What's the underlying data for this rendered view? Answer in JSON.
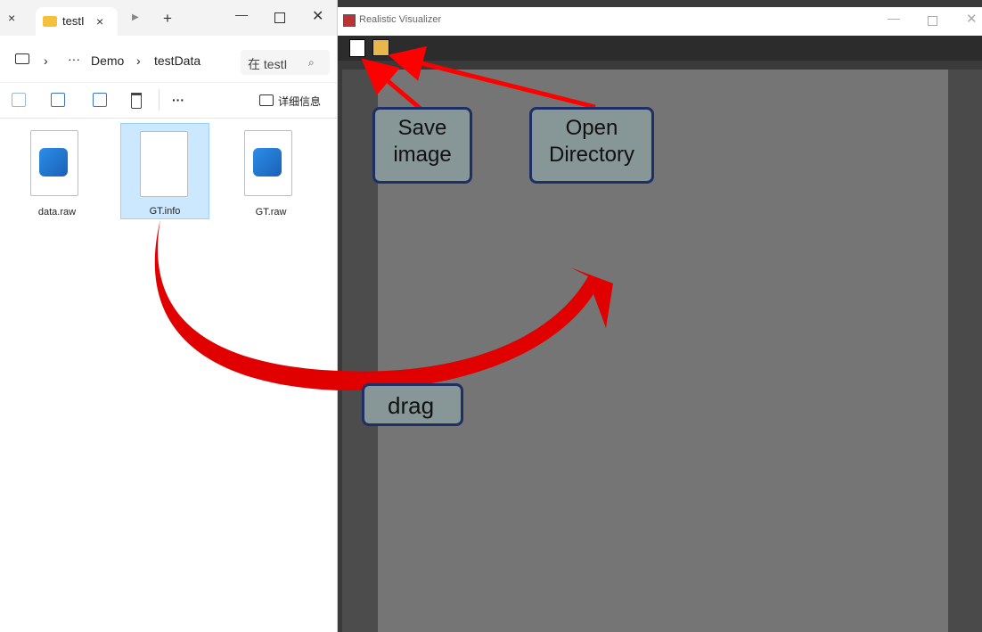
{
  "explorer": {
    "tab_label": "testI",
    "tab_close": "×",
    "new_tab": "+",
    "close_leftmost": "×",
    "breadcrumb": [
      "Demo",
      "testData"
    ],
    "search_placeholder": "在 testI",
    "details_label": "详细信息",
    "more_label": "···",
    "files": [
      {
        "name": "data.raw",
        "type": "image"
      },
      {
        "name": "GT.info",
        "type": "doc",
        "selected": true
      },
      {
        "name": "GT.raw",
        "type": "image"
      }
    ]
  },
  "visualizer": {
    "title": "Realistic Visualizer",
    "toolbar": [
      "save-icon",
      "open-directory-icon"
    ]
  },
  "annotations": {
    "save": "Save\nimage",
    "open": "Open\nDirectory",
    "drag": "drag"
  },
  "colors": {
    "arrow": "#ff0000",
    "callout_bg": "#879696",
    "callout_border": "#1e2f66"
  }
}
